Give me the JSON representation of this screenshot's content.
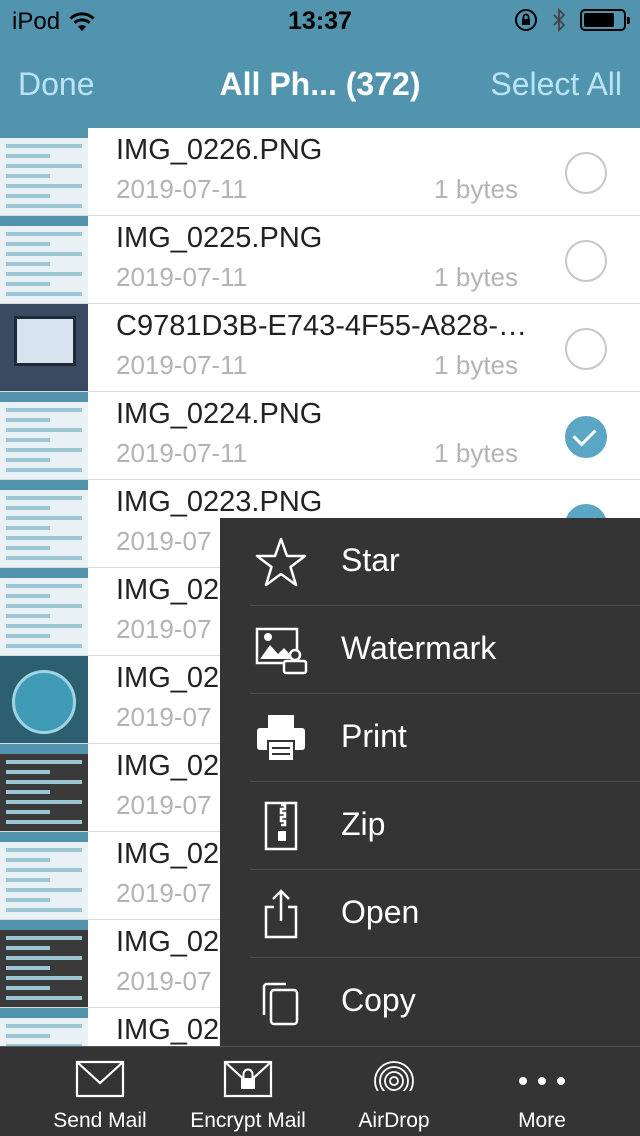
{
  "status": {
    "carrier": "iPod",
    "time": "13:37",
    "battery_level_pct": 80
  },
  "nav": {
    "done_label": "Done",
    "title": "All Ph... (372)",
    "select_all_label": "Select All"
  },
  "files": [
    {
      "name": "IMG_0226.PNG",
      "date": "2019-07-11",
      "size": "1 bytes",
      "selected": false
    },
    {
      "name": "IMG_0225.PNG",
      "date": "2019-07-11",
      "size": "1 bytes",
      "selected": false
    },
    {
      "name": "C9781D3B-E743-4F55-A828-…",
      "date": "2019-07-11",
      "size": "1 bytes",
      "selected": false
    },
    {
      "name": "IMG_0224.PNG",
      "date": "2019-07-11",
      "size": "1 bytes",
      "selected": true
    },
    {
      "name": "IMG_0223.PNG",
      "date": "2019-07",
      "size": "",
      "selected": true
    },
    {
      "name": "IMG_02",
      "date": "2019-07",
      "size": "",
      "selected": false
    },
    {
      "name": "IMG_02",
      "date": "2019-07",
      "size": "",
      "selected": false
    },
    {
      "name": "IMG_02",
      "date": "2019-07",
      "size": "",
      "selected": false
    },
    {
      "name": "IMG_02",
      "date": "2019-07",
      "size": "",
      "selected": false
    },
    {
      "name": "IMG_02",
      "date": "2019-07",
      "size": "",
      "selected": false
    },
    {
      "name": "IMG_02",
      "date": "",
      "size": "",
      "selected": false
    }
  ],
  "menu": {
    "items": [
      {
        "label": "Star",
        "icon": "star-icon"
      },
      {
        "label": "Watermark",
        "icon": "watermark-icon"
      },
      {
        "label": "Print",
        "icon": "print-icon"
      },
      {
        "label": "Zip",
        "icon": "zip-icon"
      },
      {
        "label": "Open",
        "icon": "share-icon"
      },
      {
        "label": "Copy",
        "icon": "copy-icon"
      }
    ]
  },
  "tabbar": {
    "items": [
      {
        "label": "Send Mail",
        "icon": "mail-icon"
      },
      {
        "label": "Encrypt Mail",
        "icon": "encrypted-mail-icon"
      },
      {
        "label": "AirDrop",
        "icon": "airdrop-icon"
      },
      {
        "label": "More",
        "icon": "more-icon"
      }
    ]
  },
  "colors": {
    "nav_bar": "#5294ad",
    "nav_button": "#b9e4f6",
    "check_selected": "#5aa6c4",
    "menu_bg": "#343434"
  }
}
